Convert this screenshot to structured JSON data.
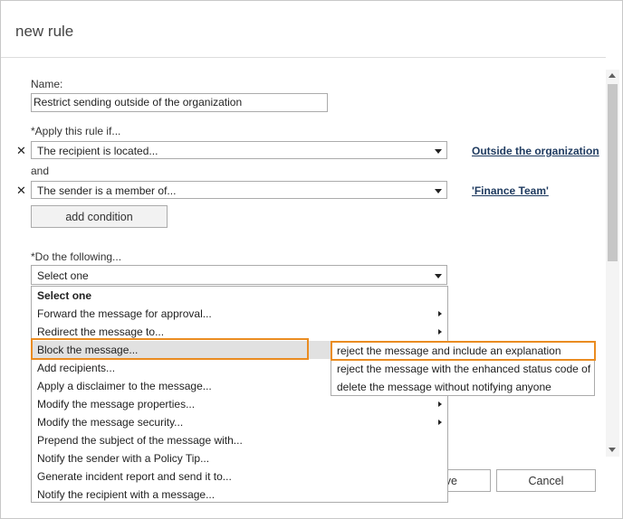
{
  "dialog": {
    "title": "new rule"
  },
  "form": {
    "name_label": "Name:",
    "name_value": "Restrict sending outside of the organization",
    "apply_label": "*Apply this rule if...",
    "condition1": {
      "value": "The recipient is located...",
      "link": "Outside the organization"
    },
    "and_label": "and",
    "condition2": {
      "value": "The sender is a member of...",
      "link": "'Finance Team'"
    },
    "add_condition_label": "add condition",
    "do_label": "*Do the following...",
    "action_value": "Select one"
  },
  "dropdown": {
    "items": [
      {
        "label": "Select one",
        "submenu": false
      },
      {
        "label": "Forward the message for approval...",
        "submenu": true
      },
      {
        "label": "Redirect the message to...",
        "submenu": true
      },
      {
        "label": "Block the message...",
        "submenu": true
      },
      {
        "label": "Add recipients...",
        "submenu": true
      },
      {
        "label": "Apply a disclaimer to the message...",
        "submenu": true
      },
      {
        "label": "Modify the message properties...",
        "submenu": true
      },
      {
        "label": "Modify the message security...",
        "submenu": true
      },
      {
        "label": "Prepend the subject of the message with...",
        "submenu": false
      },
      {
        "label": "Notify the sender with a Policy Tip...",
        "submenu": false
      },
      {
        "label": "Generate incident report and send it to...",
        "submenu": false
      },
      {
        "label": "Notify the recipient with a message...",
        "submenu": false
      }
    ],
    "highlighted_index": 3
  },
  "submenu": {
    "items": [
      "reject the message and include an explanation",
      "reject the message with the enhanced status code of",
      "delete the message without notifying anyone"
    ],
    "highlighted_index": 0
  },
  "footer": {
    "save_label_visible": "ve",
    "cancel_label": "Cancel"
  },
  "colors": {
    "highlight_border": "#ea8c21",
    "link": "#1e3a5f",
    "highlight_bg": "#e1e1e1"
  },
  "icons": {
    "remove": "close-icon",
    "dropdown": "chevron-down-icon",
    "submenu": "chevron-right-icon"
  }
}
